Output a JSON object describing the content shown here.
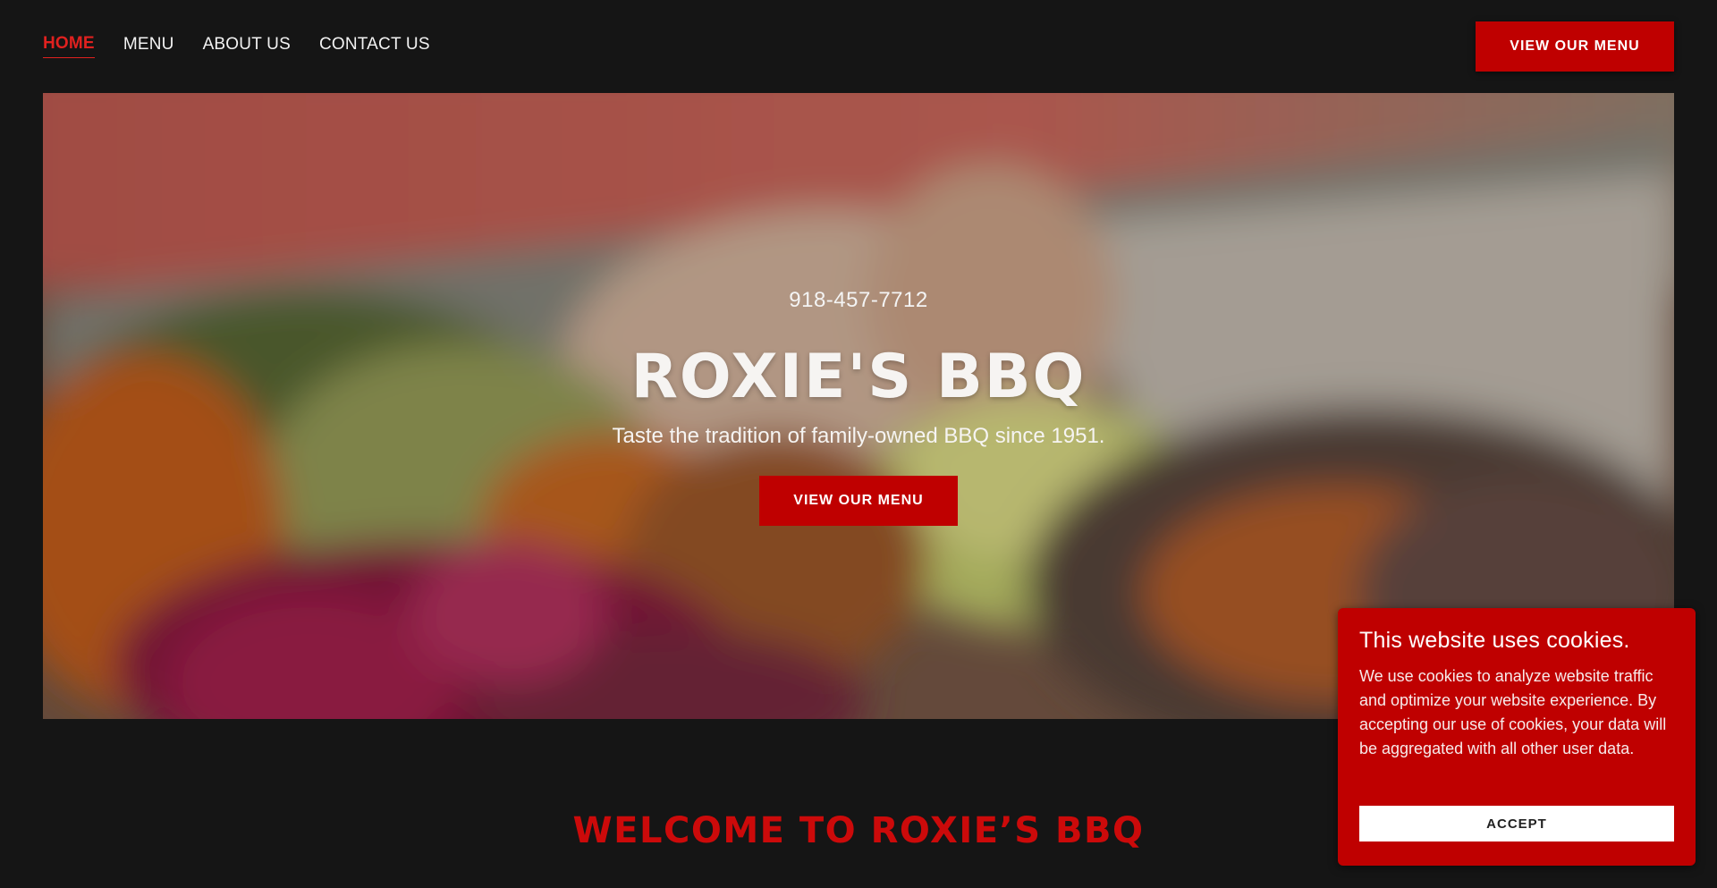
{
  "nav": {
    "items": [
      {
        "label": "HOME",
        "active": true
      },
      {
        "label": "MENU"
      },
      {
        "label": "ABOUT US"
      },
      {
        "label": "CONTACT US"
      }
    ],
    "cta_label": "VIEW OUR MENU"
  },
  "hero": {
    "phone": "918-457-7712",
    "title": "ROXIE'S BBQ",
    "tagline": "Taste the tradition of family-owned BBQ since 1951.",
    "cta_label": "VIEW OUR MENU"
  },
  "welcome": {
    "heading": "WELCOME TO ROXIE’S BBQ"
  },
  "cookie": {
    "title": "This website uses cookies.",
    "text": "We use cookies to analyze website traffic and optimize your website experience. By accepting our use of cookies, your data will be aggregated with all other user data.",
    "accept_label": "ACCEPT"
  },
  "colors": {
    "accent": "#bf0000",
    "background": "#151515",
    "active_nav": "#e0211f"
  }
}
